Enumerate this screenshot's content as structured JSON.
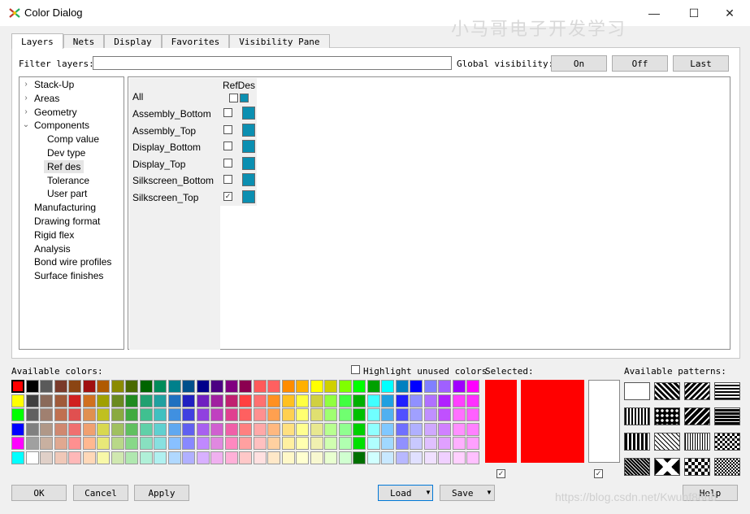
{
  "window": {
    "title": "Color Dialog",
    "watermark_top": "小马哥电子开发学习"
  },
  "tabs": [
    "Layers",
    "Nets",
    "Display",
    "Favorites",
    "Visibility Pane"
  ],
  "filter": {
    "label": "Filter layers:",
    "value": ""
  },
  "global_visibility": {
    "label": "Global visibility:",
    "on": "On",
    "off": "Off",
    "last": "Last"
  },
  "tree": [
    {
      "label": "Stack-Up",
      "arrow": "›"
    },
    {
      "label": "Areas",
      "arrow": "›"
    },
    {
      "label": "Geometry",
      "arrow": "›"
    },
    {
      "label": "Components",
      "arrow": "⌄"
    },
    {
      "label": "Comp value",
      "arrow": ""
    },
    {
      "label": "Dev type",
      "arrow": ""
    },
    {
      "label": "Ref des",
      "arrow": "",
      "selected": true
    },
    {
      "label": "Tolerance",
      "arrow": ""
    },
    {
      "label": "User part",
      "arrow": ""
    },
    {
      "label": "Manufacturing",
      "arrow": ""
    },
    {
      "label": "Drawing format",
      "arrow": ""
    },
    {
      "label": "Rigid flex",
      "arrow": ""
    },
    {
      "label": "Analysis",
      "arrow": ""
    },
    {
      "label": "Bond wire profiles",
      "arrow": ""
    },
    {
      "label": "Surface finishes",
      "arrow": ""
    }
  ],
  "grid": {
    "column": "RefDes",
    "all_label": "All",
    "rows": [
      {
        "label": "Assembly_Bottom",
        "checked": false
      },
      {
        "label": "Assembly_Top",
        "checked": false
      },
      {
        "label": "Display_Bottom",
        "checked": false
      },
      {
        "label": "Display_Top",
        "checked": false
      },
      {
        "label": "Silkscreen_Bottom",
        "checked": false
      },
      {
        "label": "Silkscreen_Top",
        "checked": true
      }
    ],
    "swatch_color": "#0b8fb1"
  },
  "available_colors": {
    "label": "Available colors:",
    "highlight_label": "Highlight unused colors",
    "highlight_checked": false,
    "rows": [
      [
        "#ff0000",
        "#000000",
        "#5a5a5a",
        "#7a3a2a",
        "#8b4513",
        "#a01010",
        "#b05a00",
        "#8b8b00",
        "#4a6a00",
        "#006400",
        "#008b5a",
        "#00808b",
        "#004f8b",
        "#00008b",
        "#4b0082",
        "#800080",
        "#8b0050",
        "#ff5a5a",
        "#ff6060",
        "#ff8c00",
        "#ffb000",
        "#ffff00",
        "#d0d000",
        "#80ff00",
        "#00ff00",
        "#00a000",
        "#00ffff",
        "#0080c0",
        "#0000ff",
        "#8080ff",
        "#a060ff",
        "#a000ff",
        "#ff00ff"
      ],
      [
        "#ffff00",
        "#404040",
        "#8a6a5a",
        "#a05a3a",
        "#d02020",
        "#d07020",
        "#a0a000",
        "#6a8a20",
        "#208a20",
        "#20a070",
        "#20a0a0",
        "#2070c0",
        "#2020c0",
        "#7020c0",
        "#a020a0",
        "#c02070",
        "#ff4040",
        "#ff7070",
        "#ff9020",
        "#ffc020",
        "#ffff40",
        "#d0d040",
        "#90ff40",
        "#40ff40",
        "#00b000",
        "#40ffff",
        "#20a0e0",
        "#2020ff",
        "#9090ff",
        "#b070ff",
        "#b020ff",
        "#ff40ff",
        "#ff30ff"
      ],
      [
        "#00ff00",
        "#606060",
        "#a08070",
        "#c07050",
        "#e05050",
        "#e09050",
        "#c0c020",
        "#8aaa40",
        "#40aa40",
        "#40c090",
        "#40c0c0",
        "#4090e0",
        "#4040e0",
        "#9040e0",
        "#c040c0",
        "#e04090",
        "#ff6060",
        "#ff9090",
        "#ffa050",
        "#ffd050",
        "#ffff70",
        "#e0e070",
        "#a0ff70",
        "#70ff70",
        "#00c000",
        "#70ffff",
        "#50b0f0",
        "#5050ff",
        "#a0a0ff",
        "#c090ff",
        "#c050ff",
        "#ff70ff",
        "#ff60ff"
      ],
      [
        "#0000ff",
        "#808080",
        "#b09888",
        "#d08870",
        "#f07070",
        "#f0a070",
        "#d8d850",
        "#a0c060",
        "#60c060",
        "#60d0a8",
        "#60d0d0",
        "#60a8f0",
        "#6060f0",
        "#a860f0",
        "#d060d0",
        "#f060a8",
        "#ff8080",
        "#ffa8a8",
        "#ffb880",
        "#ffe080",
        "#ffff90",
        "#e8e890",
        "#b8ff90",
        "#90ff90",
        "#00d000",
        "#90ffff",
        "#80c8ff",
        "#7070ff",
        "#b0b0ff",
        "#d0a8ff",
        "#d080ff",
        "#ff90ff",
        "#ff80ff"
      ],
      [
        "#ff00ff",
        "#a0a0a0",
        "#c8b0a0",
        "#e0a890",
        "#ff9090",
        "#ffb890",
        "#e8e878",
        "#b8d888",
        "#88d888",
        "#88e0c0",
        "#88e0e0",
        "#88c0ff",
        "#8888ff",
        "#c088ff",
        "#e088e0",
        "#ff88c0",
        "#ffa0a0",
        "#ffc0c0",
        "#ffd0a0",
        "#fff0a0",
        "#ffffb0",
        "#f0f0b0",
        "#d0ffb0",
        "#b0ffb0",
        "#00e000",
        "#b0ffff",
        "#a0d8ff",
        "#9090ff",
        "#c8c8ff",
        "#e0c0ff",
        "#e0a0ff",
        "#ffb0ff",
        "#ffa0ff"
      ],
      [
        "#00ffff",
        "#ffffff",
        "#e0d0c8",
        "#f0c8b8",
        "#ffb8b8",
        "#ffd8b8",
        "#f8f8a8",
        "#d0e8b0",
        "#b0e8b0",
        "#b0f0d8",
        "#b0f0f0",
        "#b0d8ff",
        "#b0b0ff",
        "#d8b0ff",
        "#f0b0f0",
        "#ffb0d8",
        "#ffc8c8",
        "#ffe0e0",
        "#ffe8c8",
        "#fff8c8",
        "#ffffd0",
        "#f8f8d0",
        "#e8ffd0",
        "#d0ffd0",
        "#007000",
        "#d0ffff",
        "#c8e8ff",
        "#b8b8ff",
        "#e0e0ff",
        "#f0e0ff",
        "#f0d0ff",
        "#ffd0ff",
        "#ffc0ff"
      ]
    ]
  },
  "selected": {
    "label": "Selected:",
    "primary": "#ff0000",
    "secondary": "#ffffff",
    "primary_checked": true,
    "secondary_checked": true
  },
  "patterns": {
    "label": "Available patterns:"
  },
  "buttons": {
    "ok": "OK",
    "cancel": "Cancel",
    "apply": "Apply",
    "load": "Load",
    "save": "Save",
    "help": "Help"
  },
  "watermark_bottom": "https://blog.csdn.net/Kwunf8866"
}
